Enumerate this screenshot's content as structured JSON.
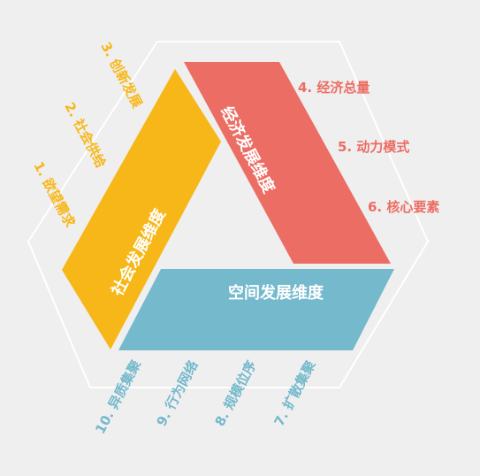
{
  "colors": {
    "background": "#efefef",
    "outline": "#ffffff",
    "social": "#f7b718",
    "economic": "#ec6d63",
    "spatial": "#74b9cc"
  },
  "dimensions": {
    "social": "社会发展维度",
    "economic": "经济发展维度",
    "spatial": "空间发展维度"
  },
  "social_items": [
    "1. 欲望需求",
    "2. 社会供给",
    "3. 创新发展"
  ],
  "economic_items": [
    "4. 经济总量",
    "5. 动力模式",
    "6. 核心要素"
  ],
  "spatial_items": [
    "7. 扩散集聚",
    "8. 规模位序",
    "9. 行为网络",
    "10. 异质集聚"
  ]
}
